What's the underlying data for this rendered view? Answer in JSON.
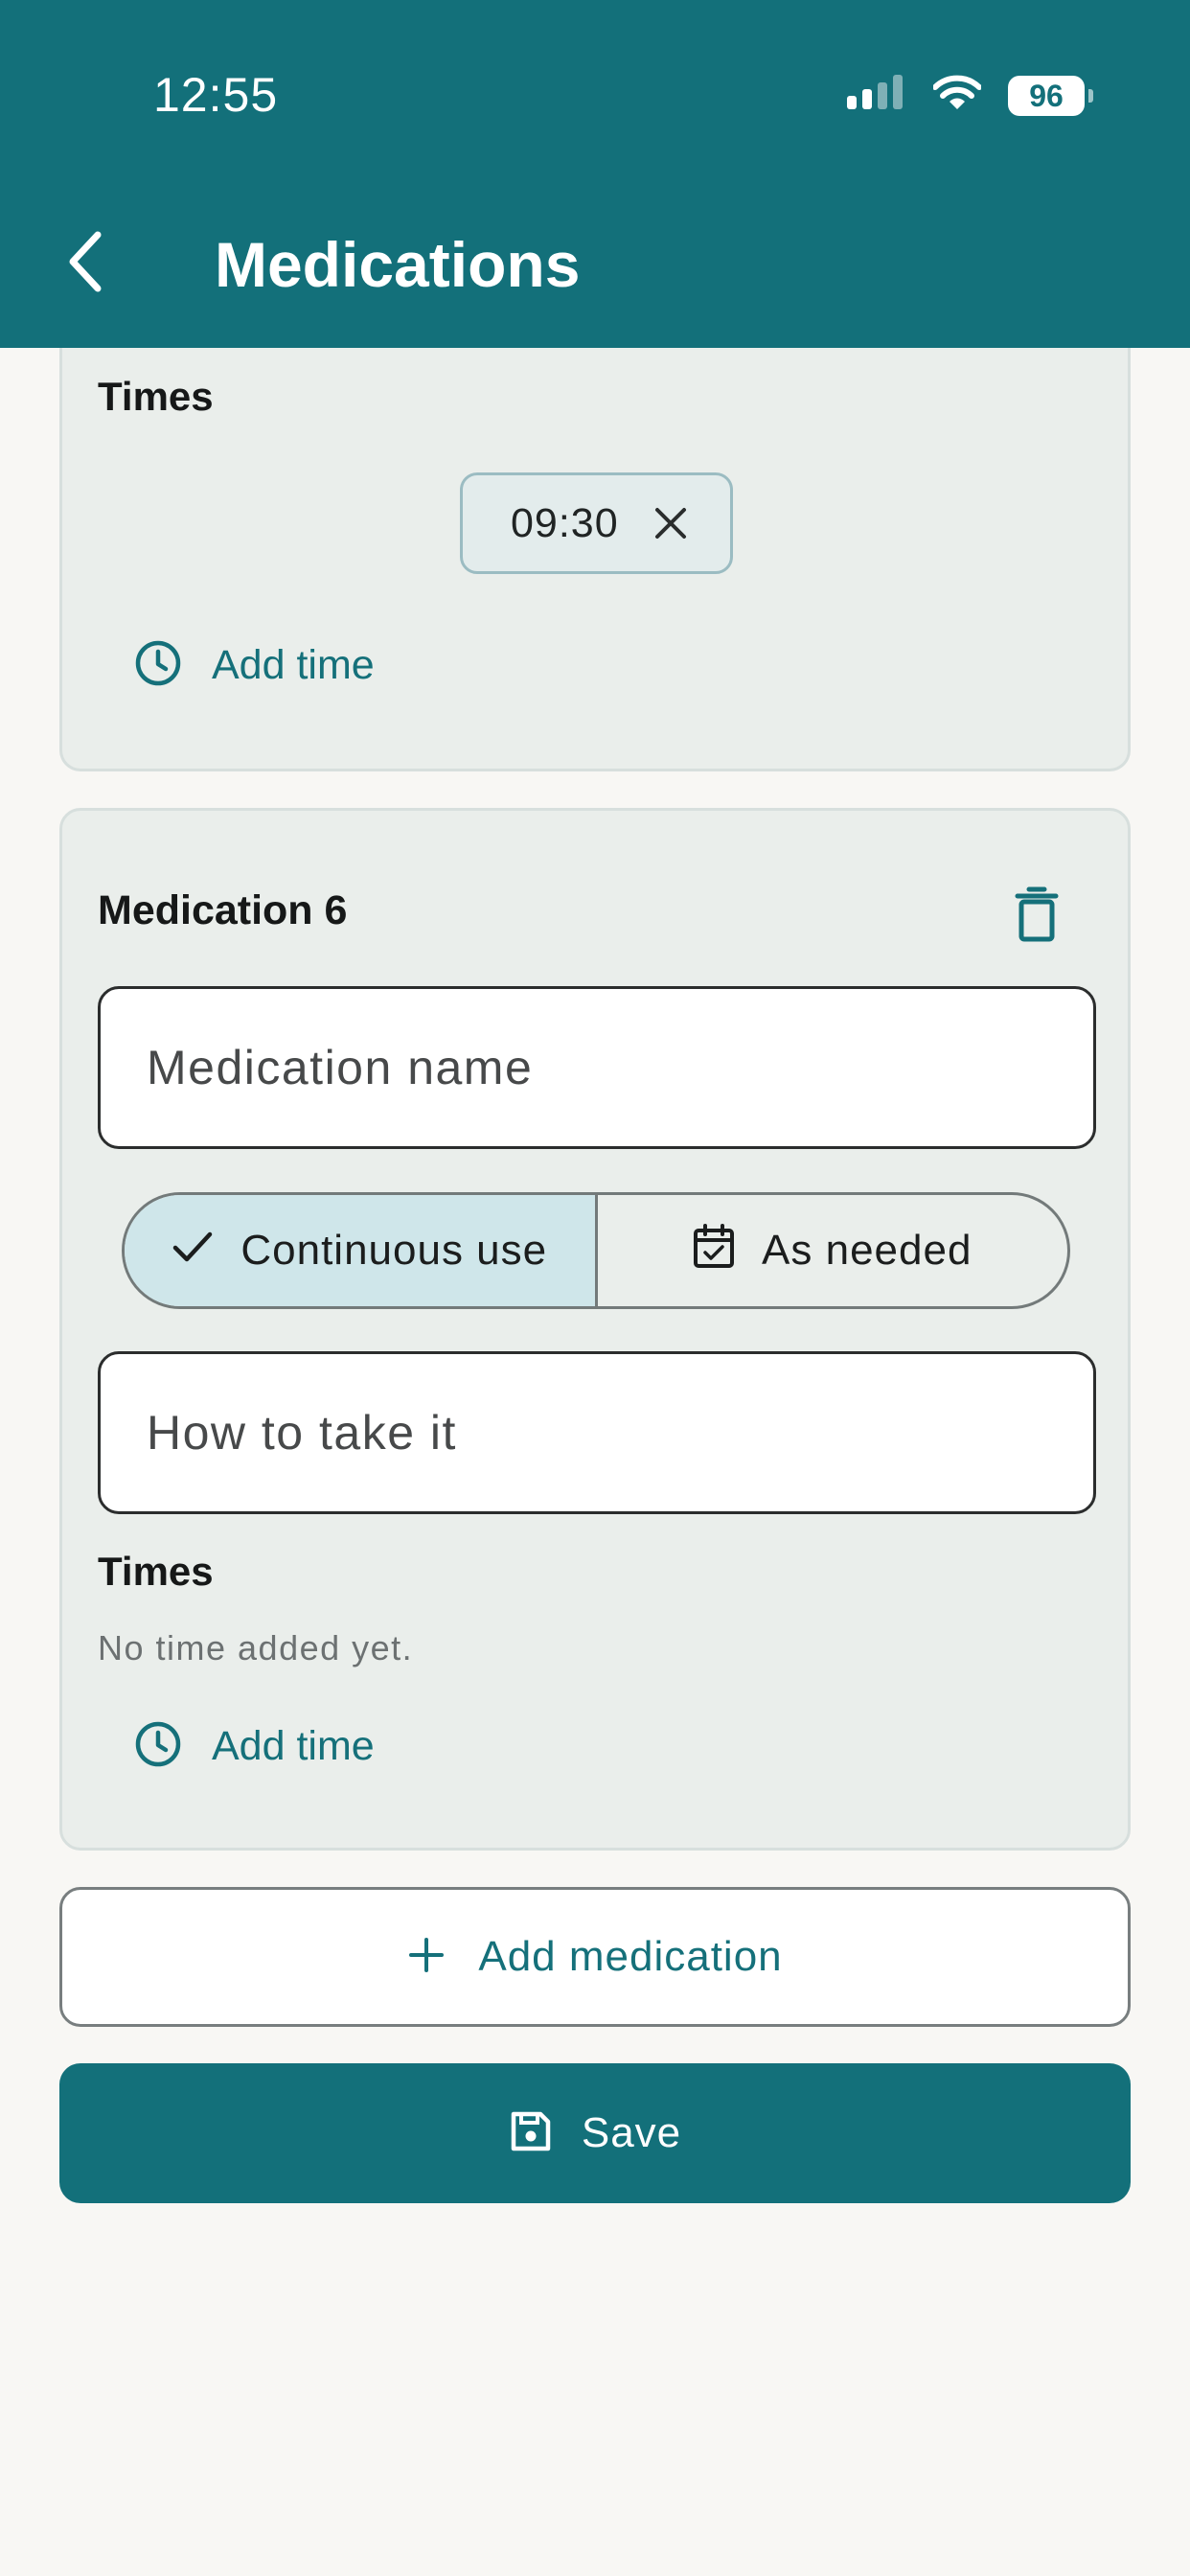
{
  "status_bar": {
    "time": "12:55",
    "battery": "96"
  },
  "app_bar": {
    "title": "Medications"
  },
  "previous_medication": {
    "times_label": "Times",
    "times": [
      "09:30"
    ],
    "add_time_label": "Add time"
  },
  "medication_6": {
    "title": "Medication 6",
    "name_placeholder": "Medication name",
    "usage_options": [
      {
        "label": "Continuous use",
        "selected": true
      },
      {
        "label": "As needed",
        "selected": false
      }
    ],
    "instructions_placeholder": "How to take it",
    "times_label": "Times",
    "no_time_text": "No time added yet.",
    "add_time_label": "Add time"
  },
  "actions": {
    "add_medication_label": "Add medication",
    "save_label": "Save"
  },
  "colors": {
    "primary": "#13707a",
    "card_background": "#eaeeeb",
    "selected_segment": "#cfe6ea",
    "page_background": "#f8f7f4"
  }
}
